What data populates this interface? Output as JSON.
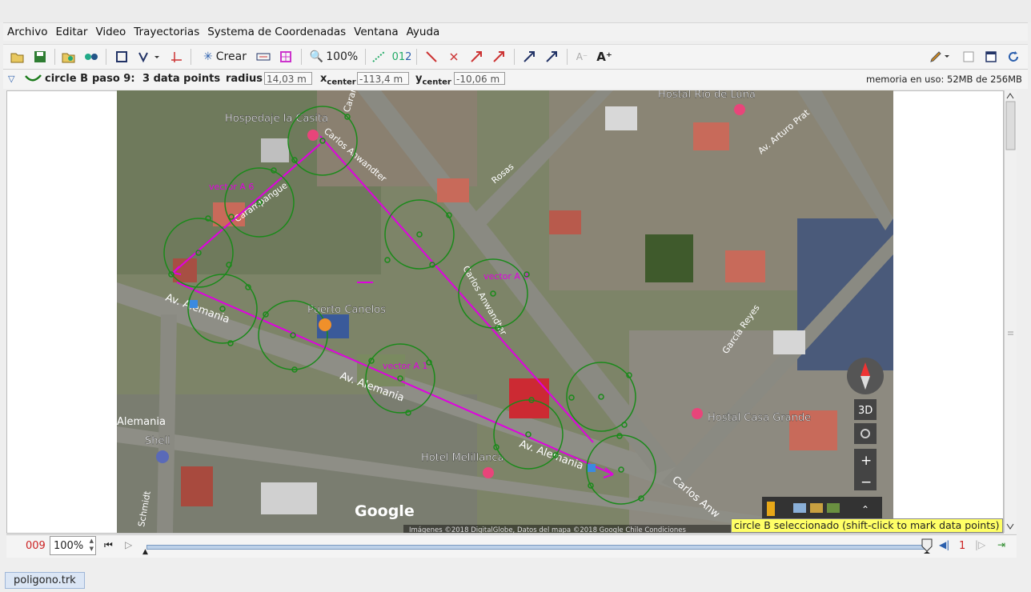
{
  "menu": [
    "Archivo",
    "Editar",
    "Video",
    "Trayectorias",
    "Systema de Coordenadas",
    "Ventana",
    "Ayuda"
  ],
  "toolbar": {
    "create_label": "Crear",
    "zoom_label": "100%"
  },
  "info": {
    "track_name": "circle B",
    "step": "paso 9:",
    "points": "3 data points",
    "radius_label": "radius",
    "radius_value": "14,03 m",
    "x_label": "x",
    "x_sub": "center",
    "x_value": "-113,4 m",
    "y_label": "y",
    "y_sub": "center",
    "y_value": "-10,06 m",
    "memory": "memoria en uso: 52MB de 256MB"
  },
  "map": {
    "places": [
      "Hospedaje la Casita",
      "Hostal Rio de Luna",
      "Puerto Canelos",
      "Shell",
      "Hotel Melillanca",
      "Hostal Casa Grande"
    ],
    "streets": [
      "Carampangue",
      "Carampangue",
      "Carlos Anwandter",
      "Carlos Anwandter",
      "Rosas",
      "Av. Arturo Prat",
      "Av. Alemania",
      "Av. Alemania",
      "Av. Alemania",
      "Alemania",
      "García Reyes",
      "Schmidt",
      "Carlos Anw"
    ],
    "vectors": [
      "vector A 6",
      "vector A 8",
      "vector A 1"
    ],
    "google": "Google",
    "attribution": "Imágenes ©2018 DigitalGlobe, Datos del mapa ©2018 Google    Chile    Condiciones",
    "ctrl_3d": "3D",
    "zoom_in": "+",
    "zoom_out": "−"
  },
  "hint": "circle B seleccionado (shift-click to mark data points)",
  "player": {
    "frame": "009",
    "zoom": "100%",
    "step_size": "1"
  },
  "tab": "poligono.trk",
  "colors": {
    "track": "#1a7a1a",
    "vector": "#e000e0",
    "frame": "#cc2222",
    "hint_bg": "#ffff66"
  }
}
